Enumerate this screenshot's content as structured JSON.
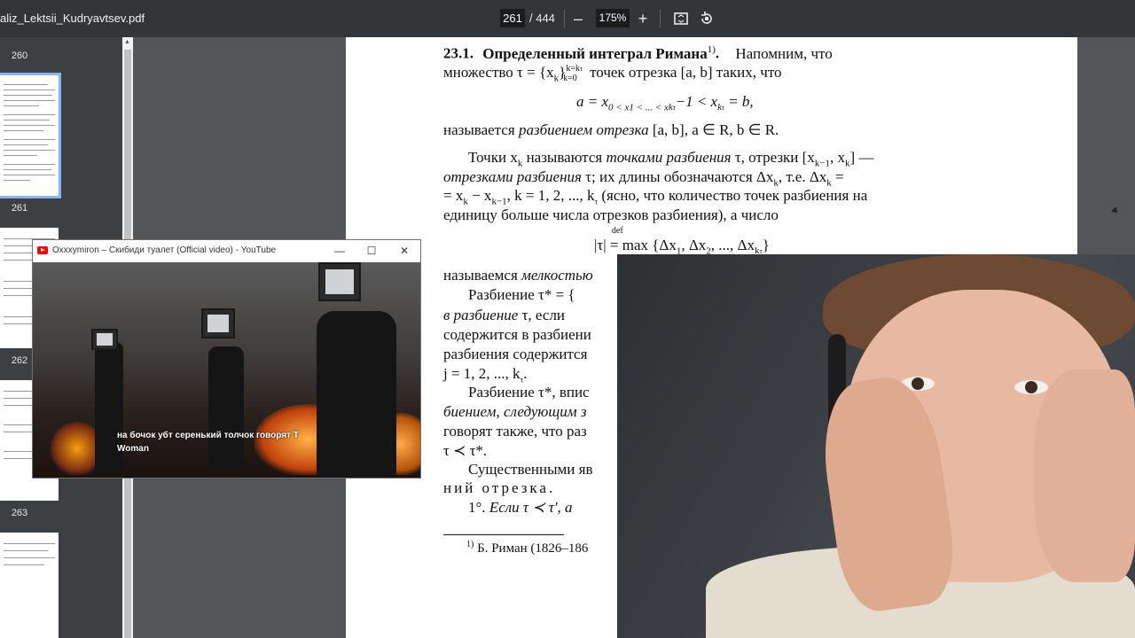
{
  "toolbar": {
    "file_name": "aliz_Lektsii_Kudryavtsev.pdf",
    "current_page": "261",
    "total_pages": "/ 444",
    "zoom_out": "–",
    "zoom": "175%",
    "zoom_in": "+"
  },
  "sidebar": {
    "pages": [
      {
        "num": "260"
      },
      {
        "num": "261"
      },
      {
        "num": "262"
      },
      {
        "num": "263"
      }
    ]
  },
  "document": {
    "heading_num": "23.1.",
    "heading_title": "Определенный интеграл Римана",
    "heading_note": "1)",
    "heading_rest": "Напомним, что",
    "l2": "множество τ = {x",
    "l2_sub": "k",
    "l2_range": "k=k",
    "l2_range_sub": "τ",
    "l2_low": "k=0",
    "l2_end": "точек отрезка [a, b] таких, что",
    "formula1": "a = x",
    "formula1_parts": "0 < x",
    "formula1_rest": "1 < ... < x",
    "formula1_rest2": "k",
    "formula1_rest3": "τ",
    "formula1_rest4": "−1 < x",
    "formula1_rest5": "k",
    "formula1_rest6": "τ",
    "formula1_end": "= b,",
    "l4_a": "называется",
    "l4_b": "разбиением отрезка",
    "l4_c": "[a, b],  a ∈ R,  b ∈ R.",
    "l5_a": "Точки x",
    "l5_sub": "k",
    "l5_b": "называются",
    "l5_c": "точками разбиения",
    "l5_d": "τ, отрезки [x",
    "l5_e": "k−1",
    "l5_f": ", x",
    "l5_g": "k",
    "l5_h": "] —",
    "l6_a": "отрезками разбиения",
    "l6_b": "τ; их длины обозначаются Δx",
    "l6_c": "k",
    "l6_d": ", т.е. Δx",
    "l6_e": "k",
    "l6_f": " =",
    "l7_a": "= x",
    "l7_b": "k",
    "l7_c": " − x",
    "l7_d": "k−1",
    "l7_e": ",  k = 1, 2, ..., k",
    "l7_f": "τ",
    "l7_g": " (ясно, что количество точек разбиения на",
    "l8": "единицу больше числа отрезков разбиения), а число",
    "formula2_a": "|τ|",
    "formula2_def": "def",
    "formula2_b": "= max {Δx",
    "formula2_c": "1",
    "formula2_d": ", Δx",
    "formula2_e": "2",
    "formula2_f": ", ..., Δx",
    "formula2_g": "k",
    "formula2_h": "τ",
    "formula2_i": "}",
    "l10_a": "называемся",
    "l10_b": "мелкостью",
    "l11_a": "Разбиение  τ* = {",
    "l12_a": "в разбиение",
    "l12_b": " τ, если",
    "l13": "содержится в разбиени",
    "l14": "разбиения  содержится",
    "l15_a": "j = 1, 2, ..., k",
    "l15_b": "τ",
    "l15_c": ".",
    "l16": "Разбиение  τ*,  впис",
    "l17_a": "биением, следующим з",
    "l18": "говорят также, что раз",
    "l19": "τ ≺ τ*.",
    "l20": "Существенными яв",
    "l21": "ний  отрезка.",
    "l22_a": "1°.",
    "l22_b": "Если  τ ≺ τ′,  a",
    "footnote_a": "1)",
    "footnote_b": " Б. Риман (1826–186"
  },
  "video_window": {
    "title": "Oxxxymiron – Скибиди туалет (Official video) - YouTube",
    "min": "—",
    "max": "☐",
    "close": "✕",
    "caption_1": "на бочок убт серенький толчок говорят Т",
    "caption_2": "Woman"
  }
}
